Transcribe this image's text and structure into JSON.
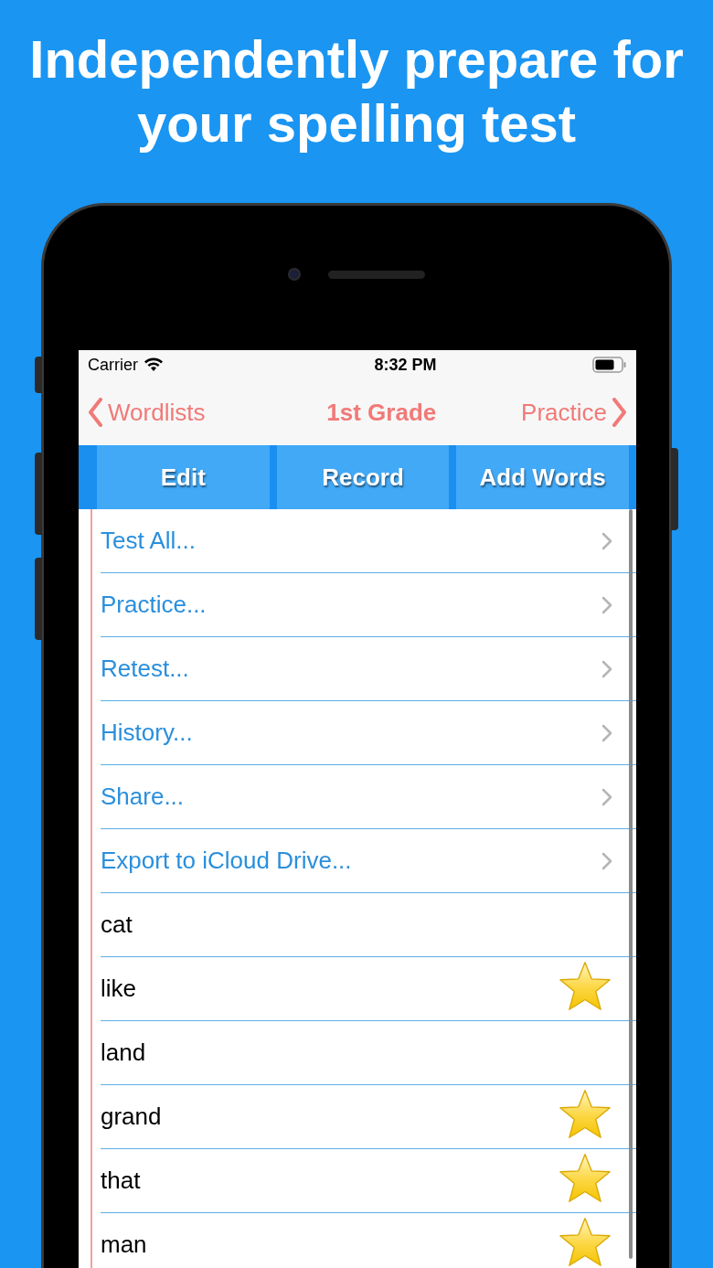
{
  "headline": [
    "Independently prepare for",
    "your spelling test"
  ],
  "status_bar": {
    "carrier": "Carrier",
    "time": "8:32 PM"
  },
  "nav": {
    "back": "Wordlists",
    "title": "1st Grade",
    "forward": "Practice"
  },
  "toolbar": [
    "Edit",
    "Record",
    "Add Words"
  ],
  "rows": [
    {
      "kind": "action",
      "label": "Test All..."
    },
    {
      "kind": "action",
      "label": "Practice..."
    },
    {
      "kind": "action",
      "label": "Retest..."
    },
    {
      "kind": "action",
      "label": "History..."
    },
    {
      "kind": "action",
      "label": "Share..."
    },
    {
      "kind": "action",
      "label": "Export to iCloud Drive..."
    },
    {
      "kind": "word",
      "label": "cat",
      "starred": false
    },
    {
      "kind": "word",
      "label": "like",
      "starred": true
    },
    {
      "kind": "word",
      "label": "land",
      "starred": false
    },
    {
      "kind": "word",
      "label": "grand",
      "starred": true
    },
    {
      "kind": "word",
      "label": "that",
      "starred": true
    },
    {
      "kind": "word",
      "label": "man",
      "starred": true
    }
  ]
}
